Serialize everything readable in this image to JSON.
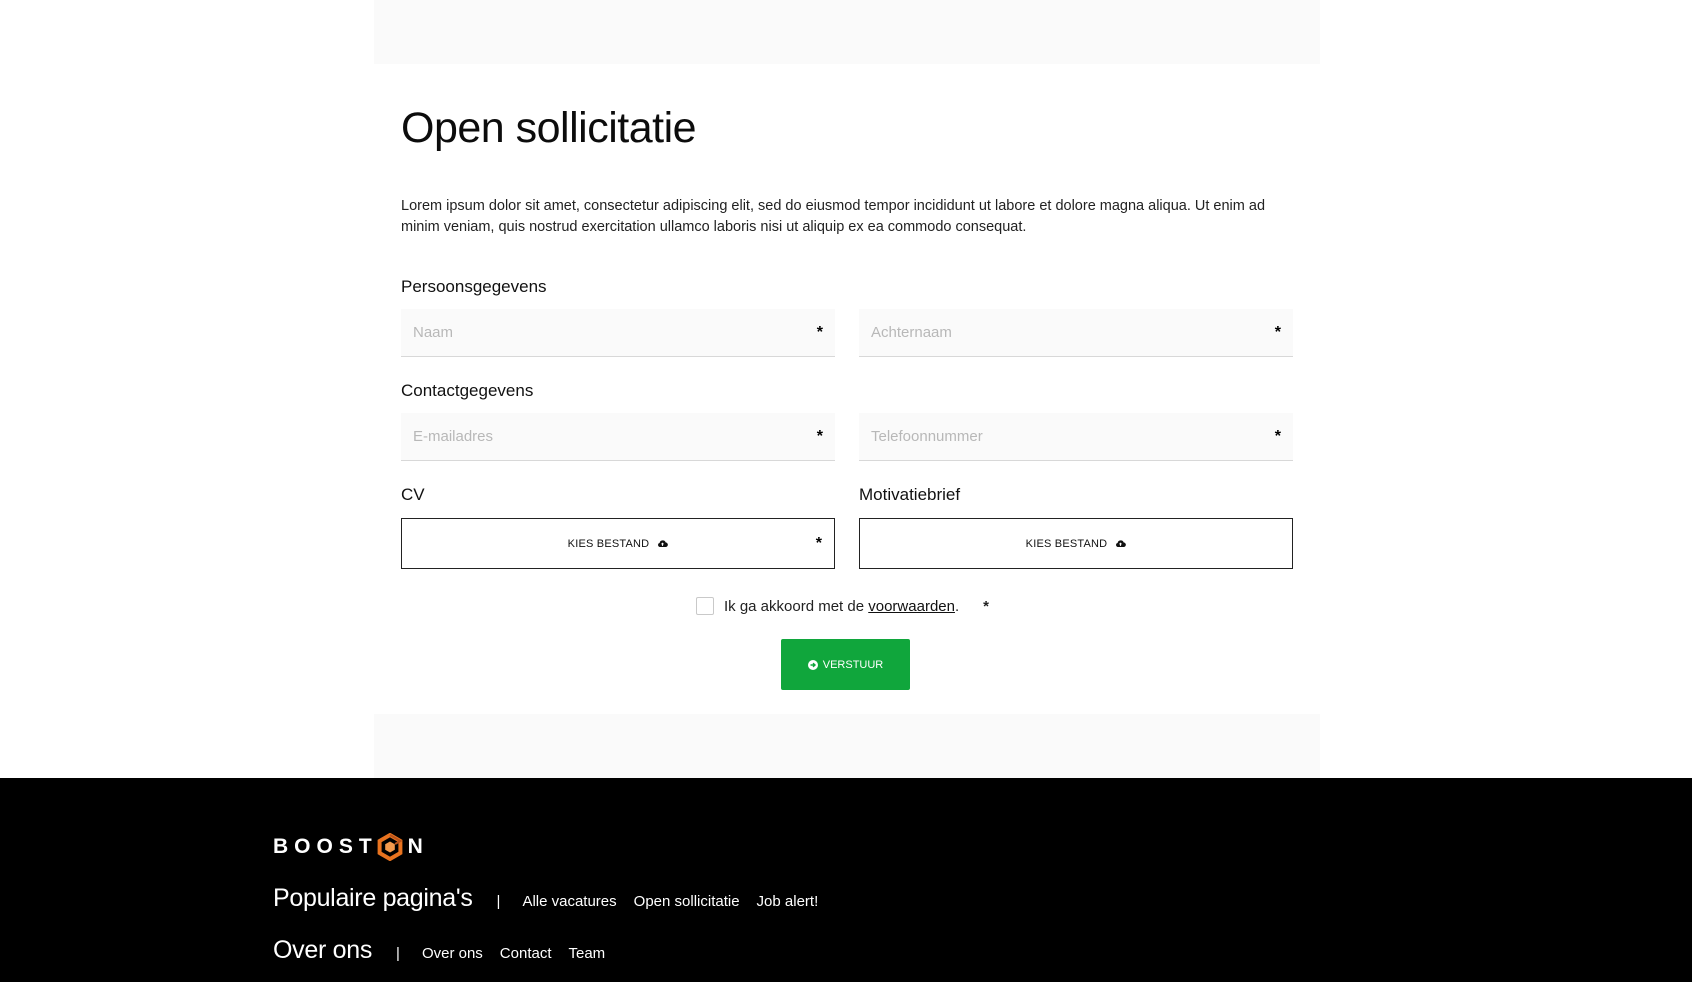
{
  "page": {
    "title": "Open sollicitatie",
    "intro": "Lorem ipsum dolor sit amet, consectetur adipiscing elit, sed do eiusmod tempor incididunt ut labore et dolore magna aliqua. Ut enim ad minim veniam, quis nostrud exercitation ullamco laboris nisi ut aliquip ex ea commodo consequat."
  },
  "form": {
    "personal": {
      "label": "Persoonsgegevens",
      "first_name_placeholder": "Naam",
      "last_name_placeholder": "Achternaam"
    },
    "contact": {
      "label": "Contactgegevens",
      "email_placeholder": "E-mailadres",
      "phone_placeholder": "Telefoonnummer"
    },
    "cv": {
      "label": "CV",
      "button": "KIES BESTAND"
    },
    "letter": {
      "label": "Motivatiebrief",
      "button": "KIES BESTAND"
    },
    "required_mark": "*",
    "agree": {
      "prefix": "Ik ga akkoord met de",
      "link": "voorwaarden",
      "suffix": "."
    },
    "submit_label": "VERSTUUR",
    "submit_color": "#10a63c"
  },
  "footer": {
    "logo": {
      "text_left": "BOOST",
      "text_right": "N",
      "icon": "hexagon-logo-icon",
      "accent": "#e8731f"
    },
    "rows": [
      {
        "heading": "Populaire pagina's",
        "separator": "|",
        "links": [
          "Alle vacatures",
          "Open sollicitatie",
          "Job alert!"
        ]
      },
      {
        "heading": "Over ons",
        "separator": "|",
        "links": [
          "Over ons",
          "Contact",
          "Team"
        ]
      }
    ]
  }
}
